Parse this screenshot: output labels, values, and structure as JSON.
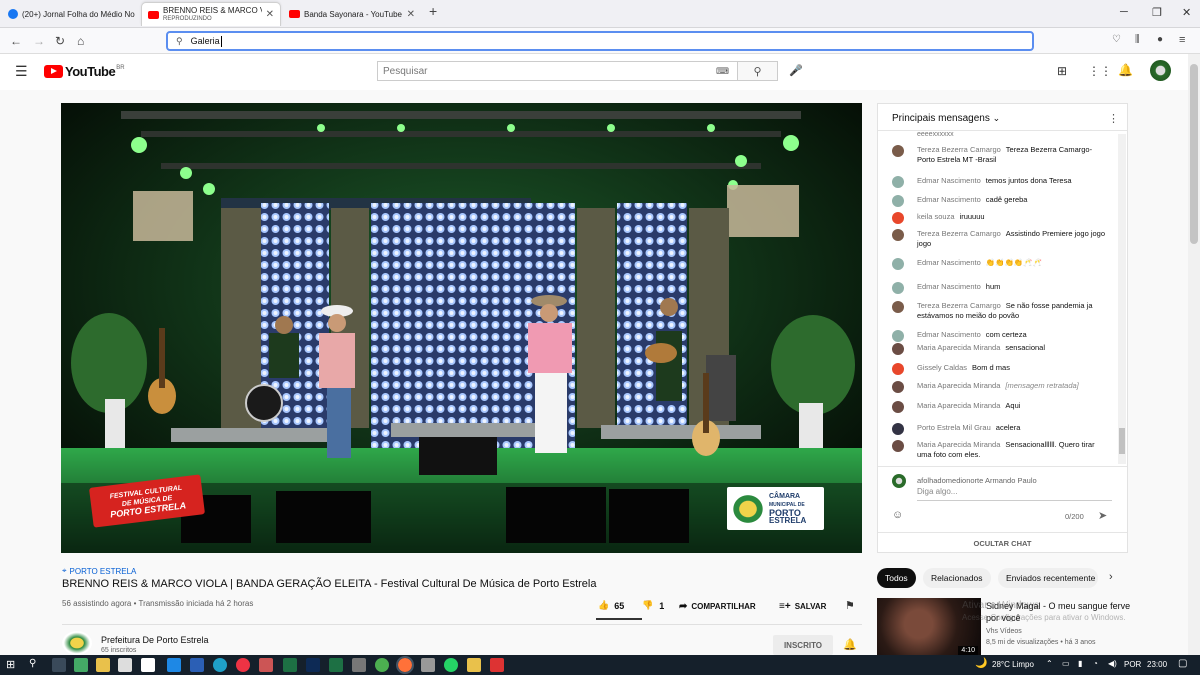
{
  "browser": {
    "tabs": [
      {
        "label": "(20+) Jornal Folha do Médio No"
      },
      {
        "label": "BRENNO REIS & MARCO VIOLA",
        "sub": "REPRODUZINDO"
      },
      {
        "label": "Banda Sayonara - YouTube"
      }
    ],
    "url": "Galeria"
  },
  "youtube": {
    "logo": "YouTube",
    "region": "BR",
    "search_placeholder": "Pesquisar"
  },
  "video": {
    "location": "PORTO ESTRELA",
    "title": "BRENNO REIS & MARCO VIOLA | BANDA GERAÇÃO ELEITA - Festival Cultural De Música de Porto Estrela",
    "stats": "56 assistindo agora • Transmissão iniciada há 2 horas",
    "likes": "65",
    "dislikes": "1",
    "share": "COMPARTILHAR",
    "save": "SALVAR",
    "channel": "Prefeitura De Porto Estrela",
    "subs": "65 inscritos",
    "subscribed": "INSCRITO",
    "overlay_festival": [
      "FESTIVAL CULTURAL",
      "DE MÚSICA DE",
      "PORTO ESTRELA"
    ],
    "overlay_badge": [
      "CÂMARA",
      "MUNICIPAL DE",
      "PORTO",
      "ESTRELA"
    ]
  },
  "chat": {
    "header": "Principais mensagens",
    "top_fragment": "eeeexxxxxx",
    "messages": [
      {
        "author": "Tereza Bezerra Camargo",
        "text": "Tereza Bezerra Camargo- Porto Estrela MT -Brasil",
        "color": "#7a5c4a"
      },
      {
        "author": "Edmar Nascimento",
        "text": "temos juntos dona Teresa",
        "color": "#8fb0a8"
      },
      {
        "author": "Edmar Nascimento",
        "text": "cadê gereba",
        "color": "#8fb0a8"
      },
      {
        "author": "keila souza",
        "text": "iruuuuu",
        "color": "#e8472b"
      },
      {
        "author": "Tereza Bezerra Camargo",
        "text": "Assistindo Premiere jogo jogo jogo",
        "color": "#7a5c4a"
      },
      {
        "author": "Edmar Nascimento",
        "text": "👏👏👏👏🥂🥂",
        "color": "#8fb0a8"
      },
      {
        "author": "Edmar Nascimento",
        "text": "hum",
        "color": "#8fb0a8"
      },
      {
        "author": "Tereza Bezerra Camargo",
        "text": "Se não fosse pandemia ja estávamos no meião do povão",
        "color": "#7a5c4a"
      },
      {
        "author": "Edmar Nascimento",
        "text": "com certeza",
        "color": "#8fb0a8"
      },
      {
        "author": "Maria Aparecida Miranda",
        "text": "sensacional",
        "color": "#6b4d44"
      },
      {
        "author": "Gissely Caldas",
        "text": "Bom d mas",
        "color": "#e8472b"
      },
      {
        "author": "Maria Aparecida Miranda",
        "text": "[mensagem retratada]",
        "color": "#6b4d44",
        "retracted": true
      },
      {
        "author": "Maria Aparecida Miranda",
        "text": "Aqui",
        "color": "#6b4d44"
      },
      {
        "author": "Porto Estrela Mil Grau",
        "text": "acelera",
        "color": "#334"
      },
      {
        "author": "Maria Aparecida Miranda",
        "text": "Sensacionallllll. Quero tirar uma foto com eles.",
        "color": "#6b4d44"
      }
    ],
    "input_user": "afolhadomedionorte Armando Paulo",
    "input_placeholder": "Diga algo...",
    "counter": "0/200",
    "hide": "OCULTAR CHAT"
  },
  "filters": [
    "Todos",
    "Relacionados",
    "Enviados recentemente"
  ],
  "suggestion": {
    "title": "Sidney Magal - O meu sangue ferve por você",
    "channel": "Vhs Vídeos",
    "meta": "8,5 mi de visualizações • há 3 anos",
    "duration": "4:10"
  },
  "watermark": [
    "Ativar o Windows",
    "Acesse Configurações para ativar o Windows."
  ],
  "taskbar": {
    "weather": "28°C  Limpo",
    "lang": "POR",
    "time": "23:00"
  }
}
